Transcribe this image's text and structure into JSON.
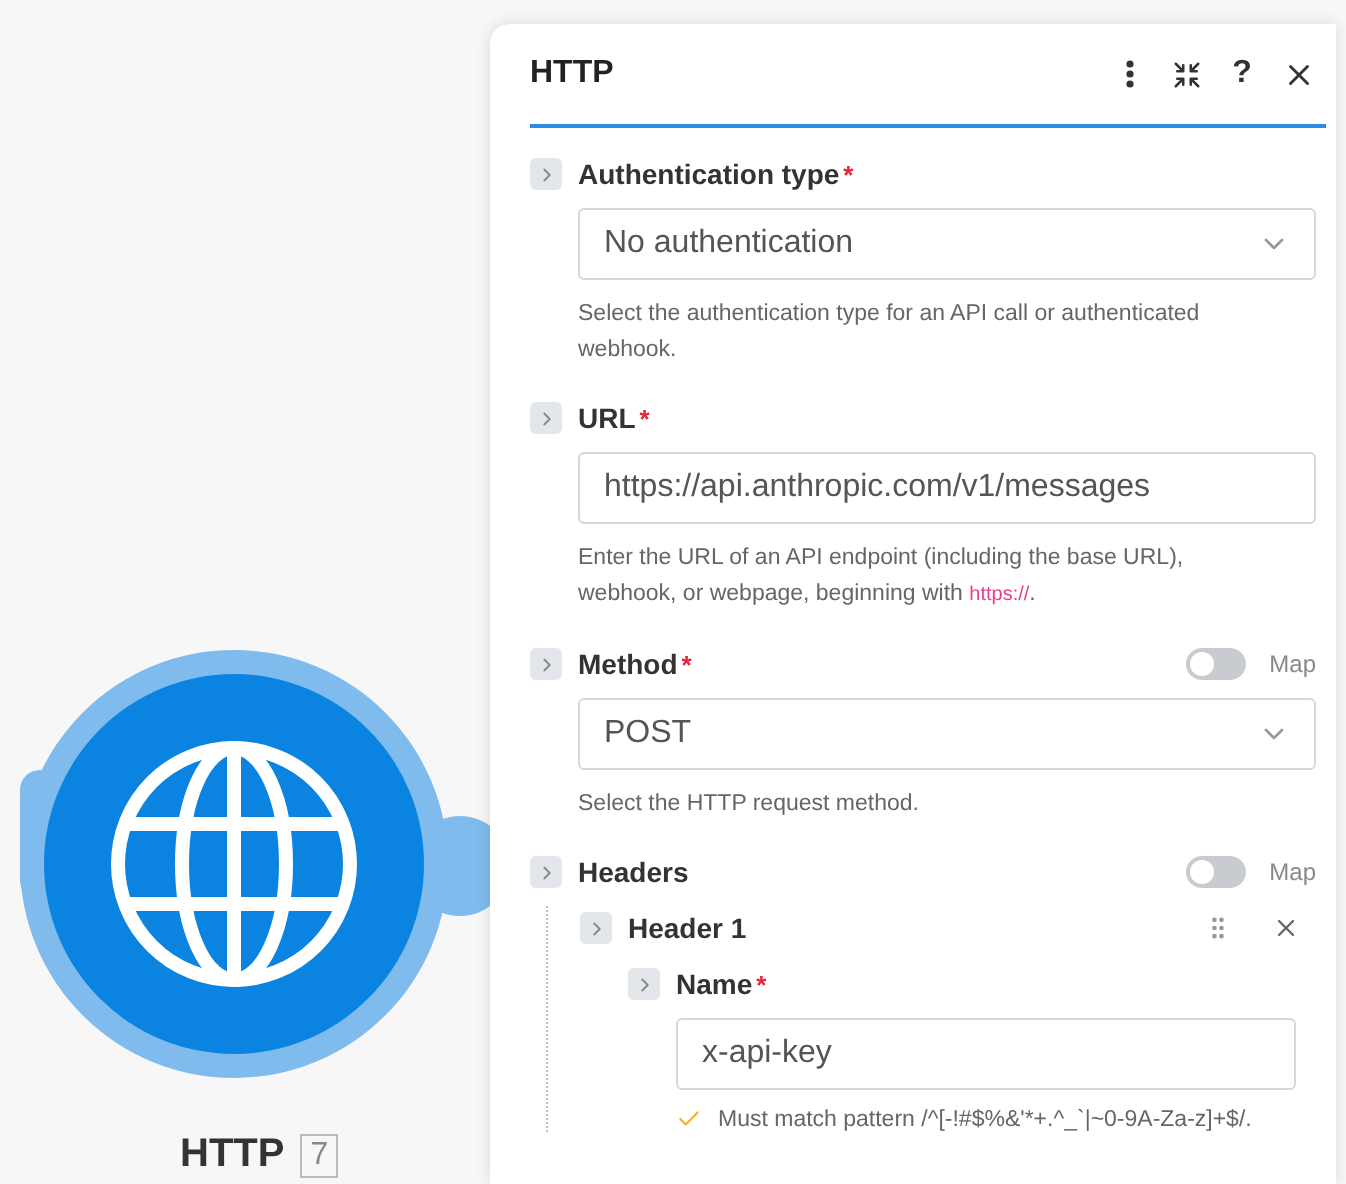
{
  "module": {
    "name": "HTTP",
    "badge": "7"
  },
  "panel": {
    "title": "HTTP",
    "help_label": "?",
    "required_mark": "*",
    "fields": [
      {
        "kind": "select",
        "label": "Authentication type",
        "required": true,
        "value": "No authentication",
        "help": "Select the authentication type for an API call or authenticated webhook."
      },
      {
        "kind": "text",
        "label": "URL",
        "required": true,
        "value": "https://api.anthropic.com/v1/messages",
        "help": "Enter the URL of an API endpoint (including the base URL), webhook, or webpage, beginning with ",
        "help_link": "https://",
        "help_tail": "."
      },
      {
        "kind": "select",
        "label": "Method",
        "required": true,
        "value": "POST",
        "help": "Select the HTTP request method.",
        "map": {
          "label": "Map",
          "on": false
        }
      },
      {
        "kind": "group",
        "label": "Headers",
        "required": false,
        "map": {
          "label": "Map",
          "on": false
        },
        "items": [
          {
            "label": "Header 1",
            "fields": [
              {
                "kind": "text",
                "label": "Name",
                "required": true,
                "value": "x-api-key",
                "validation": "Must match pattern /^[-!#$%&'*+.^_`|~0-9A-Za-z]+$/."
              }
            ]
          }
        ]
      }
    ]
  }
}
